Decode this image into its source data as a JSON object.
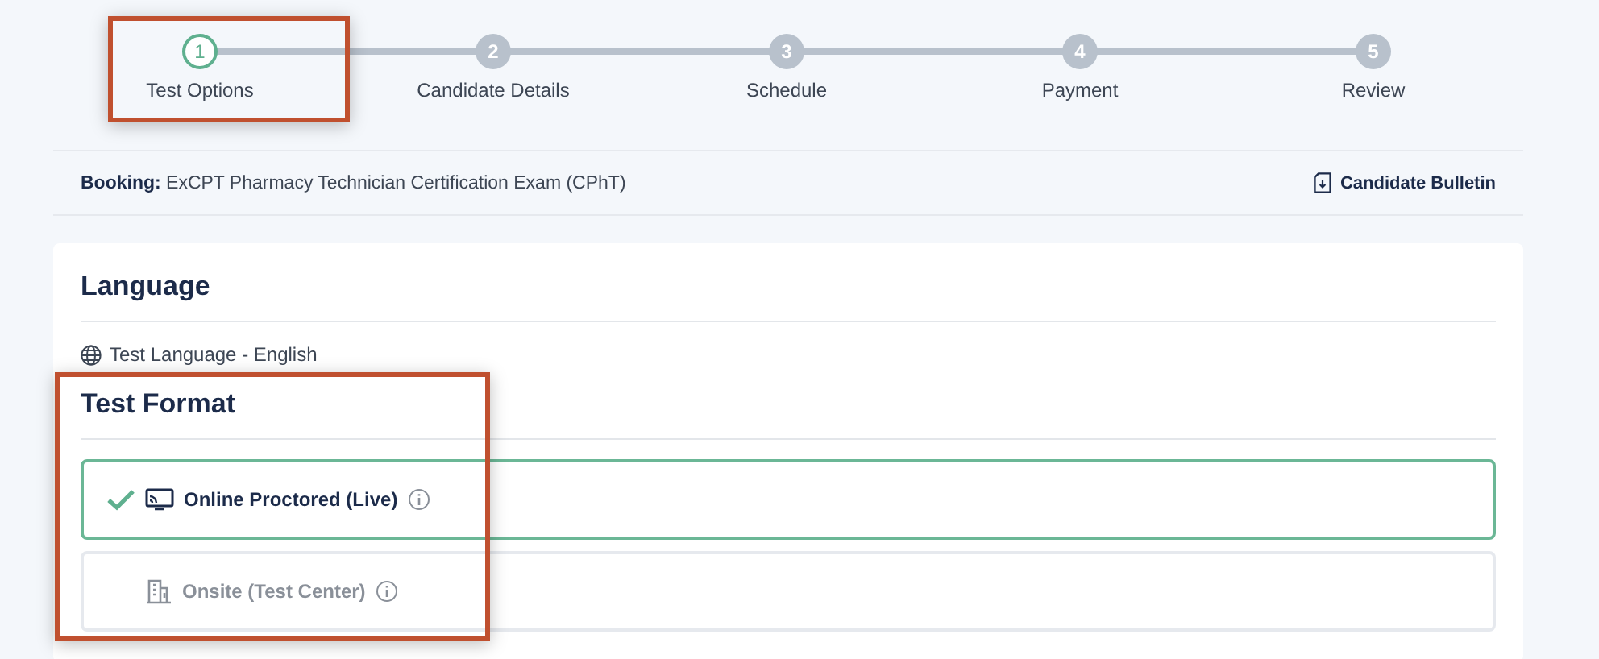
{
  "steps": [
    {
      "number": "1",
      "label": "Test Options",
      "selected": true,
      "annotated": true
    },
    {
      "number": "2",
      "label": "Candidate Details",
      "selected": false,
      "annotated": false
    },
    {
      "number": "3",
      "label": "Schedule",
      "selected": false,
      "annotated": false
    },
    {
      "number": "4",
      "label": "Payment",
      "selected": false,
      "annotated": false
    },
    {
      "number": "5",
      "label": "Review",
      "selected": false,
      "annotated": false
    }
  ],
  "booking": {
    "text": "**Booking:** ExCPT Pharmacy Technician Certification Exam (CPhT)",
    "link": "Candidate Bulletin"
  },
  "language": {
    "heading": "Language",
    "value": "Test Language - English"
  },
  "test_format": {
    "heading": "Test Format",
    "annotated": true,
    "options": [
      {
        "label": "Online Proctored (Live)",
        "kind": "online",
        "selected": true
      },
      {
        "label": "Onsite (Test Center)",
        "kind": "onsite",
        "selected": false
      }
    ]
  }
}
